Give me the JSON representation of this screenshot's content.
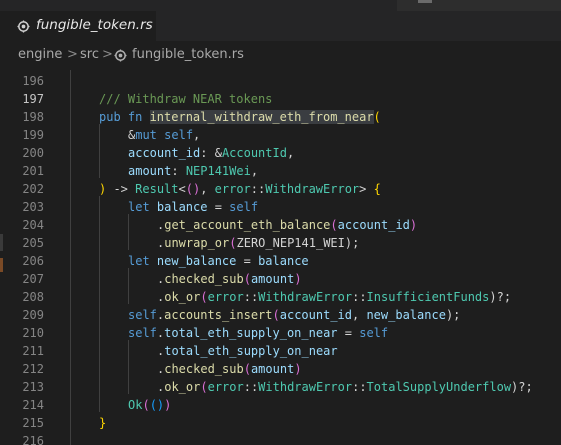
{
  "tab": {
    "filename": "fungible_token.rs",
    "icon": "rust-file-icon"
  },
  "breadcrumb": {
    "items": [
      "engine",
      "src",
      "fungible_token.rs"
    ],
    "separator": ">"
  },
  "editor": {
    "current_line": "197",
    "line_numbers": [
      "196",
      "197",
      "198",
      "199",
      "200",
      "201",
      "202",
      "203",
      "204",
      "205",
      "206",
      "207",
      "208",
      "209",
      "210",
      "211",
      "212",
      "213",
      "214",
      "215",
      "216"
    ],
    "lines": {
      "l197_comment": "/// Withdraw NEAR tokens",
      "l198_pub": "pub fn ",
      "l198_name": "internal_withdraw_eth_from_near",
      "l198_paren": "(",
      "l199_amp": "&",
      "l199_mut": "mut ",
      "l199_self": "self",
      "l199_comma": ",",
      "l200_param": "account_id",
      "l200_colon": ": &",
      "l200_type": "AccountId",
      "l200_comma": ",",
      "l201_param": "amount",
      "l201_colon": ": ",
      "l201_type": "NEP141Wei",
      "l201_comma": ",",
      "l202_close": ")",
      "l202_arrow": " -> ",
      "l202_result": "Result",
      "l202_lt": "<",
      "l202_unit": "()",
      "l202_comma": ", ",
      "l202_error": "error",
      "l202_sep": "::",
      "l202_etype": "WithdrawError",
      "l202_gt": "> ",
      "l202_brace": "{",
      "l203_let": "let ",
      "l203_var": "balance",
      "l203_eq": " = ",
      "l203_self": "self",
      "l204_dot": ".",
      "l204_fn": "get_account_eth_balance",
      "l204_open": "(",
      "l204_arg": "account_id",
      "l204_close": ")",
      "l205_dot": ".",
      "l205_fn": "unwrap_or",
      "l205_open": "(",
      "l205_arg": "ZERO_NEP141_WEI",
      "l205_close": ");",
      "l206_let": "let ",
      "l206_var": "new_balance",
      "l206_eq": " = ",
      "l206_rhs": "balance",
      "l207_dot": ".",
      "l207_fn": "checked_sub",
      "l207_open": "(",
      "l207_arg": "amount",
      "l207_close": ")",
      "l208_dot": ".",
      "l208_fn": "ok_or",
      "l208_open": "(",
      "l208_mod": "error",
      "l208_sep": "::",
      "l208_ty": "WithdrawError",
      "l208_sep2": "::",
      "l208_variant": "InsufficientFunds",
      "l208_close": ")?;",
      "l209_self": "self",
      "l209_dot": ".",
      "l209_fn": "accounts_insert",
      "l209_open": "(",
      "l209_arg1": "account_id",
      "l209_comma": ", ",
      "l209_arg2": "new_balance",
      "l209_close": ");",
      "l210_self": "self",
      "l210_dot": ".",
      "l210_field": "total_eth_supply_on_near",
      "l210_eq": " = ",
      "l210_rhs": "self",
      "l211_dot": ".",
      "l211_field": "total_eth_supply_on_near",
      "l212_dot": ".",
      "l212_fn": "checked_sub",
      "l212_open": "(",
      "l212_arg": "amount",
      "l212_close": ")",
      "l213_dot": ".",
      "l213_fn": "ok_or",
      "l213_open": "(",
      "l213_mod": "error",
      "l213_sep": "::",
      "l213_ty": "WithdrawError",
      "l213_sep2": "::",
      "l213_variant": "TotalSupplyUnderflow",
      "l213_close": ")?;",
      "l214_ok": "Ok",
      "l214_open": "(",
      "l214_unit": "()",
      "l214_close": ")",
      "l215_brace": "}"
    }
  },
  "colors": {
    "keyword": "#569cd6",
    "function": "#dcdcaa",
    "type": "#4ec9b0",
    "variable": "#9cdcfe",
    "comment": "#6a9955",
    "constant": "#4fc1ff",
    "selection": "#264f78",
    "background": "#1e1e1e"
  }
}
